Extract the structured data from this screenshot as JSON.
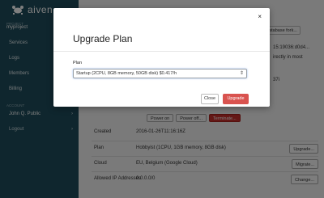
{
  "app": {
    "name": "aiven"
  },
  "sidebar": {
    "project_label": "PROJECT",
    "project_name": "myproject",
    "items": [
      {
        "label": "Services"
      },
      {
        "label": "Logs"
      },
      {
        "label": "Members"
      },
      {
        "label": "Billing"
      }
    ],
    "account_label": "ACCOUNT",
    "account_name": "John Q. Public",
    "logout_label": "Logout",
    "chevron": "›"
  },
  "main": {
    "peek": {
      "fork_button": "database fork...",
      "hash_text": "15:19036:d0d4...",
      "directly_text": "irectly in most",
      "num_text": "37i"
    },
    "actions": {
      "power_on": "Power on",
      "power_off": "Power off...",
      "terminate": "Terminate..."
    },
    "details": [
      {
        "label": "Created",
        "value": "2016-01-26T11:16:16Z",
        "button": ""
      },
      {
        "label": "Plan",
        "value": "Hobbyist (1CPU, 1GB memory, 8GB disk)",
        "button": "Upgrade..."
      },
      {
        "label": "Cloud",
        "value": "EU, Belgium (Google Cloud)",
        "button": "Migrate..."
      },
      {
        "label": "Allowed IP Addresses",
        "value": "0.0.0.0/0",
        "button": "Change..."
      }
    ]
  },
  "modal": {
    "title": "Upgrade Plan",
    "close_icon": "×",
    "plan_label": "Plan",
    "plan_selected": "Startup (2CPU, 8GB memory, 50GB disk) $0.417/h",
    "select_arrow": "⇕",
    "close_button": "Close",
    "upgrade_button": "Upgrade"
  },
  "colors": {
    "sidebar": "#1e4c5c",
    "danger": "#d9534f",
    "overlay": "rgba(0,0,0,0.5)"
  }
}
